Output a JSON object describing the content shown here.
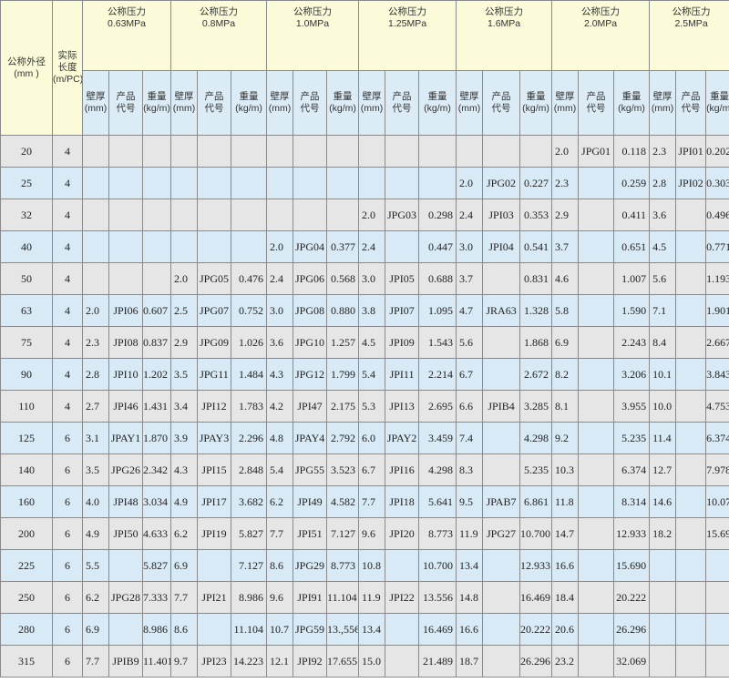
{
  "header": {
    "outer_diameter": [
      "公称外径",
      "(mm )"
    ],
    "actual_length": [
      "实际",
      "长度",
      "(m/PC)"
    ],
    "pressure_prefix": "公称压力",
    "sub": {
      "wall": [
        "壁厚",
        "(mm)"
      ],
      "code": [
        "产品",
        "代号"
      ],
      "weight": [
        "重量",
        "(kg/m)"
      ]
    }
  },
  "pressures": [
    "0.63MPa",
    "0.8MPa",
    "1.0MPa",
    "1.25MPa",
    "1.6MPa",
    "2.0MPa",
    "2.5MPa"
  ],
  "rows": [
    {
      "od": "20",
      "len": "4",
      "cells": [
        [
          "",
          "",
          ""
        ],
        [
          "",
          "",
          ""
        ],
        [
          "",
          "",
          ""
        ],
        [
          "",
          "",
          ""
        ],
        [
          "",
          "",
          ""
        ],
        [
          "2.0",
          "JPG01",
          "0.118"
        ],
        [
          "2.3",
          "JPI01",
          "0.202"
        ]
      ]
    },
    {
      "od": "25",
      "len": "4",
      "cells": [
        [
          "",
          "",
          ""
        ],
        [
          "",
          "",
          ""
        ],
        [
          "",
          "",
          ""
        ],
        [
          "",
          "",
          ""
        ],
        [
          "2.0",
          "JPG02",
          "0.227"
        ],
        [
          "2.3",
          "",
          "0.259"
        ],
        [
          "2.8",
          "JPI02",
          "0.303"
        ]
      ]
    },
    {
      "od": "32",
      "len": "4",
      "cells": [
        [
          "",
          "",
          ""
        ],
        [
          "",
          "",
          ""
        ],
        [
          "",
          "",
          ""
        ],
        [
          "2.0",
          "JPG03",
          "0.298"
        ],
        [
          "2.4",
          "JPI03",
          "0.353"
        ],
        [
          "2.9",
          "",
          "0.411"
        ],
        [
          "3.6",
          "",
          "0.496"
        ]
      ]
    },
    {
      "od": "40",
      "len": "4",
      "cells": [
        [
          "",
          "",
          ""
        ],
        [
          "",
          "",
          ""
        ],
        [
          "2.0",
          "JPG04",
          "0.377"
        ],
        [
          "2.4",
          "",
          "0.447"
        ],
        [
          "3.0",
          "JPI04",
          "0.541"
        ],
        [
          "3.7",
          "",
          "0.651"
        ],
        [
          "4.5",
          "",
          "0.771"
        ]
      ]
    },
    {
      "od": "50",
      "len": "4",
      "cells": [
        [
          "",
          "",
          ""
        ],
        [
          "2.0",
          "JPG05",
          "0.476"
        ],
        [
          "2.4",
          "JPG06",
          "0.568"
        ],
        [
          "3.0",
          "JPI05",
          "0.688"
        ],
        [
          "3.7",
          "",
          "0.831"
        ],
        [
          "4.6",
          "",
          "1.007"
        ],
        [
          "5.6",
          "",
          "1.193"
        ]
      ]
    },
    {
      "od": "63",
      "len": "4",
      "cells": [
        [
          "2.0",
          "JPI06",
          "0.607"
        ],
        [
          "2.5",
          "JPG07",
          "0.752"
        ],
        [
          "3.0",
          "JPG08",
          "0.880"
        ],
        [
          "3.8",
          "JPI07",
          "1.095"
        ],
        [
          "4.7",
          "JRA63",
          "1.328"
        ],
        [
          "5.8",
          "",
          "1.590"
        ],
        [
          "7.1",
          "",
          "1.901"
        ]
      ]
    },
    {
      "od": "75",
      "len": "4",
      "cells": [
        [
          "2.3",
          "JPI08",
          "0.837"
        ],
        [
          "2.9",
          "JPG09",
          "1.026"
        ],
        [
          "3.6",
          "JPG10",
          "1.257"
        ],
        [
          "4.5",
          "JPI09",
          "1.543"
        ],
        [
          "5.6",
          "",
          "1.868"
        ],
        [
          "6.9",
          "",
          "2.243"
        ],
        [
          "8.4",
          "",
          "2.667"
        ]
      ]
    },
    {
      "od": "90",
      "len": "4",
      "cells": [
        [
          "2.8",
          "JPI10",
          "1.202"
        ],
        [
          "3.5",
          "JPG11",
          "1.484"
        ],
        [
          "4.3",
          "JPG12",
          "1.799"
        ],
        [
          "5.4",
          "JPI11",
          "2.214"
        ],
        [
          "6.7",
          "",
          "2.672"
        ],
        [
          "8.2",
          "",
          "3.206"
        ],
        [
          "10.1",
          "",
          "3.843"
        ]
      ]
    },
    {
      "od": "110",
      "len": "4",
      "cells": [
        [
          "2.7",
          "JPI46",
          "1.431"
        ],
        [
          "3.4",
          "JPI12",
          "1.783"
        ],
        [
          "4.2",
          "JPI47",
          "2.175"
        ],
        [
          "5.3",
          "JPI13",
          "2.695"
        ],
        [
          "6.6",
          "JPIB4",
          "3.285"
        ],
        [
          "8.1",
          "",
          "3.955"
        ],
        [
          "10.0",
          "",
          "4.753"
        ]
      ]
    },
    {
      "od": "125",
      "len": "6",
      "cells": [
        [
          "3.1",
          "JPAY1",
          "1.870"
        ],
        [
          "3.9",
          "JPAY3",
          "2.296"
        ],
        [
          "4.8",
          "JPAY4",
          "2.792"
        ],
        [
          "6.0",
          "JPAY2",
          "3.459"
        ],
        [
          "7.4",
          "",
          "4.298"
        ],
        [
          "9.2",
          "",
          "5.235"
        ],
        [
          "11.4",
          "",
          "6.374"
        ]
      ]
    },
    {
      "od": "140",
      "len": "6",
      "cells": [
        [
          "3.5",
          "JPG26",
          "2.342"
        ],
        [
          "4.3",
          "JPI15",
          "2.848"
        ],
        [
          "5.4",
          "JPG55",
          "3.523"
        ],
        [
          "6.7",
          "JPI16",
          "4.298"
        ],
        [
          "8.3",
          "",
          "5.235"
        ],
        [
          "10.3",
          "",
          "6.374"
        ],
        [
          "12.7",
          "",
          "7.978"
        ]
      ]
    },
    {
      "od": "160",
      "len": "6",
      "cells": [
        [
          "4.0",
          "JPI48",
          "3.034"
        ],
        [
          "4.9",
          "JPI17",
          "3.682"
        ],
        [
          "6.2",
          "JPI49",
          "4.582"
        ],
        [
          "7.7",
          "JPI18",
          "5.641"
        ],
        [
          "9.5",
          "JPAB7",
          "6.861"
        ],
        [
          "11.8",
          "",
          "8.314"
        ],
        [
          "14.6",
          "",
          "10.071"
        ]
      ]
    },
    {
      "od": "200",
      "len": "6",
      "cells": [
        [
          "4.9",
          "JPI50",
          "4.633"
        ],
        [
          "6.2",
          "JPI19",
          "5.827"
        ],
        [
          "7.7",
          "JPI51",
          "7.127"
        ],
        [
          "9.6",
          "JPI20",
          "8.773"
        ],
        [
          "11.9",
          "JPG27",
          "10.700"
        ],
        [
          "14.7",
          "",
          "12.933"
        ],
        [
          "18.2",
          "",
          "15.690"
        ]
      ]
    },
    {
      "od": "225",
      "len": "6",
      "cells": [
        [
          "5.5",
          "",
          "5.827"
        ],
        [
          "6.9",
          "",
          "7.127"
        ],
        [
          "8.6",
          "JPG29",
          "8.773"
        ],
        [
          "10.8",
          "",
          "10.700"
        ],
        [
          "13.4",
          "",
          "12.933"
        ],
        [
          "16.6",
          "",
          "15.690"
        ],
        [
          "",
          "",
          ""
        ]
      ]
    },
    {
      "od": "250",
      "len": "6",
      "cells": [
        [
          "6.2",
          "JPG28",
          "7.333"
        ],
        [
          "7.7",
          "JPI21",
          "8.986"
        ],
        [
          "9.6",
          "JPI91",
          "11.104"
        ],
        [
          "11.9",
          "JPI22",
          "13.556"
        ],
        [
          "14.8",
          "",
          "16.469"
        ],
        [
          "18.4",
          "",
          "20.222"
        ],
        [
          "",
          "",
          ""
        ]
      ]
    },
    {
      "od": "280",
      "len": "6",
      "cells": [
        [
          "6.9",
          "",
          "8.986"
        ],
        [
          "8.6",
          "",
          "11.104"
        ],
        [
          "10.7",
          "JPG59",
          "13.,556"
        ],
        [
          "13.4",
          "",
          "16.469"
        ],
        [
          "16.6",
          "",
          "20.222"
        ],
        [
          "20.6",
          "",
          "26.296"
        ],
        [
          "",
          "",
          ""
        ]
      ]
    },
    {
      "od": "315",
      "len": "6",
      "cells": [
        [
          "7.7",
          "JPIB9",
          "11.401"
        ],
        [
          "9.7",
          "JPI23",
          "14.223"
        ],
        [
          "12.1",
          "JPI92",
          "17.655"
        ],
        [
          "15.0",
          "",
          "21.489"
        ],
        [
          "18.7",
          "",
          "26.296"
        ],
        [
          "23.2",
          "",
          "32.069"
        ],
        [
          "",
          "",
          ""
        ]
      ]
    }
  ]
}
